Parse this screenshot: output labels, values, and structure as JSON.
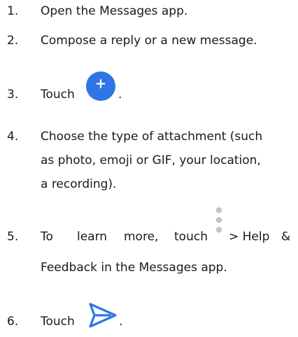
{
  "steps": [
    {
      "number": "1.",
      "lines": [
        "Open the Messages app."
      ]
    },
    {
      "number": "2.",
      "lines": [
        "Compose a reply or a new message."
      ]
    },
    {
      "number": "3.",
      "before_icon": "Touch",
      "icon": "plus-circle-icon",
      "after_icon": "."
    },
    {
      "number": "4.",
      "lines": [
        "Choose the type of attachment (such",
        "as photo, emoji or GIF, your location,",
        "a recording)."
      ]
    },
    {
      "number": "5.",
      "parts": [
        "To",
        "learn",
        "more,",
        "touch"
      ],
      "icon": "more-vertical-icon",
      "after_icon": [
        "> Help",
        "&"
      ],
      "lines": [
        "Feedback in the Messages app."
      ]
    },
    {
      "number": "6.",
      "before_icon": "Touch",
      "icon": "send-icon",
      "after_icon": "."
    }
  ],
  "colors": {
    "text": "#1a1a1a",
    "accent_blue": "#2e76e6",
    "menu_dots": "#c4c4c4"
  }
}
